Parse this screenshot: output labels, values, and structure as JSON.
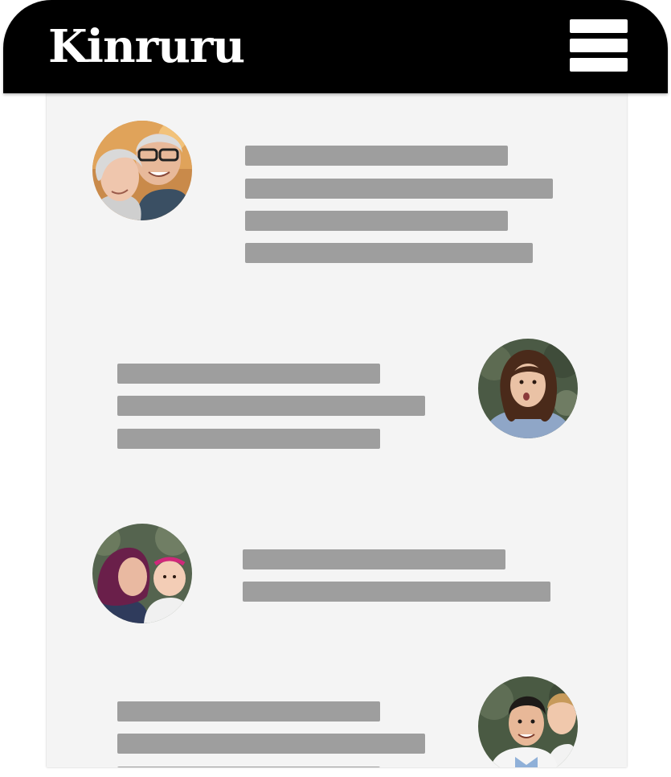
{
  "app": {
    "brand": "Kinruru",
    "menu_icon": "hamburger-menu-icon"
  },
  "colors": {
    "header_bg": "#000000",
    "brand_text": "#ffffff",
    "content_bg": "#f4f4f4",
    "placeholder": "#9e9e9e"
  },
  "feed": {
    "items": [
      {
        "avatar": "avatar-elderly-couple",
        "side": "left",
        "placeholder_lines": 4
      },
      {
        "avatar": "avatar-young-woman",
        "side": "right",
        "placeholder_lines": 3
      },
      {
        "avatar": "avatar-mother-and-baby",
        "side": "left",
        "placeholder_lines": 2
      },
      {
        "avatar": "avatar-young-couple",
        "side": "right",
        "placeholder_lines": 3
      }
    ]
  }
}
